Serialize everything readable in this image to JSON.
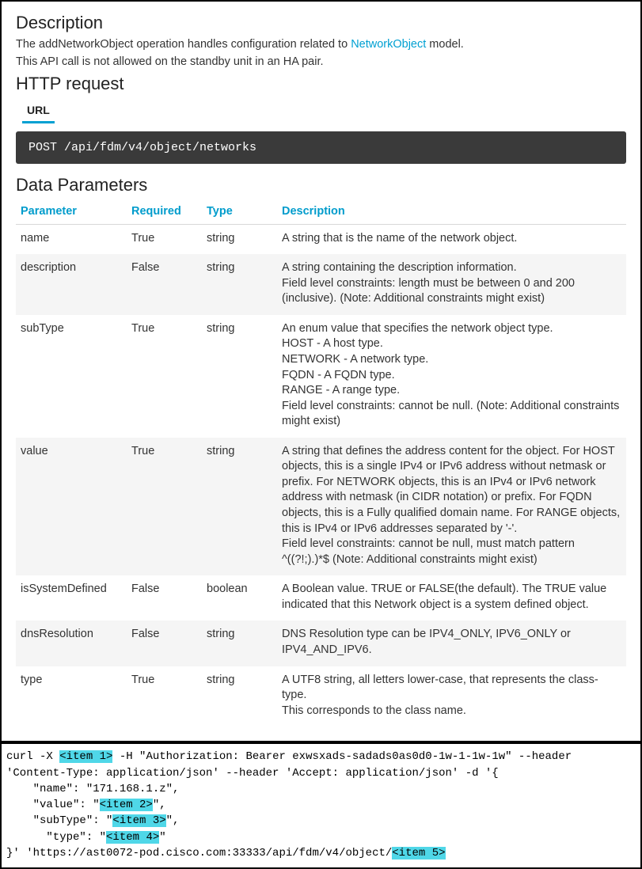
{
  "sections": {
    "description_heading": "Description",
    "desc_line1a": "The addNetworkObject operation handles configuration related to ",
    "desc_link": "NetworkObject",
    "desc_line1b": " model.",
    "desc_line2": "This API call is not allowed on the standby unit in an HA pair.",
    "http_heading": "HTTP request",
    "tab_url": "URL",
    "endpoint": "POST /api/fdm/v4/object/networks",
    "data_params_heading": "Data Parameters"
  },
  "table": {
    "headers": {
      "param": "Parameter",
      "required": "Required",
      "type": "Type",
      "desc": "Description"
    },
    "rows": [
      {
        "param": "name",
        "required": "True",
        "type": "string",
        "desc": "A string that is the name of the network object."
      },
      {
        "param": "description",
        "required": "False",
        "type": "string",
        "desc": "A string containing the description information.\nField level constraints: length must be between 0 and 200 (inclusive). (Note: Additional constraints might exist)"
      },
      {
        "param": "subType",
        "required": "True",
        "type": "string",
        "desc": "An enum value that specifies the network object type.\nHOST - A host type.\nNETWORK - A network type.\nFQDN - A FQDN type.\nRANGE - A range type.\nField level constraints: cannot be null. (Note: Additional constraints might exist)"
      },
      {
        "param": "value",
        "required": "True",
        "type": "string",
        "desc": "A string that defines the address content for the object. For HOST objects, this is a single IPv4 or IPv6 address without netmask or prefix. For NETWORK objects, this is an IPv4 or IPv6 network address with netmask (in CIDR notation) or prefix. For FQDN objects, this is a Fully qualified domain name. For RANGE objects, this is IPv4 or IPv6 addresses separated by '-'.\nField level constraints: cannot be null, must match pattern ^((?!;).)*$ (Note: Additional constraints might exist)"
      },
      {
        "param": "isSystemDefined",
        "required": "False",
        "type": "boolean",
        "desc": "A Boolean value. TRUE or FALSE(the default). The TRUE value indicated that this Network object is a system defined object."
      },
      {
        "param": "dnsResolution",
        "required": "False",
        "type": "string",
        "desc": "DNS Resolution type can be IPV4_ONLY, IPV6_ONLY or IPV4_AND_IPV6."
      },
      {
        "param": "type",
        "required": "True",
        "type": "string",
        "desc": "A UTF8 string, all letters lower-case, that represents the class-type.\nThis corresponds to the class name."
      }
    ]
  },
  "curl": {
    "l1a": "curl -X ",
    "item1": "<item 1>",
    "l1b": " -H \"Authorization: Bearer exwsxads-sadads0as0d0-1w-1-1w-1w\" --header",
    "l2": "'Content-Type: application/json' --header 'Accept: application/json' -d '{",
    "l3": "    \"name\": \"171.168.1.z\",",
    "l4a": "    \"value\": \"",
    "item2": "<item 2>",
    "l4b": "\",",
    "l5a": "    \"subType\": \"",
    "item3": "<item 3>",
    "l5b": "\",",
    "l6a": "      \"type\": \"",
    "item4": "<item 4>",
    "l6b": "\"",
    "l7a": "}' 'https://ast0072-pod.cisco.com:33333/api/fdm/v4/object/",
    "item5": "<item 5>"
  }
}
